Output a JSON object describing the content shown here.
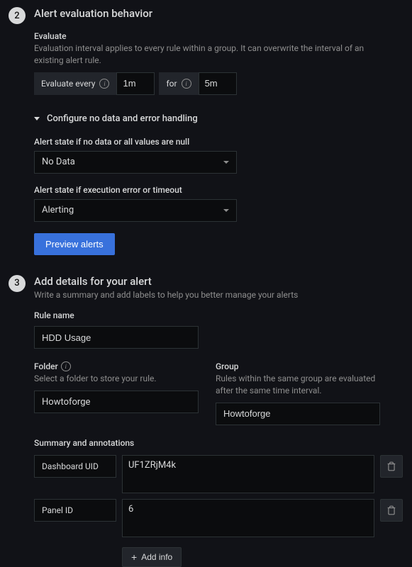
{
  "section2": {
    "step": "2",
    "title": "Alert evaluation behavior",
    "evaluate_label": "Evaluate",
    "evaluate_desc": "Evaluation interval applies to every rule within a group. It can overwrite the interval of an existing alert rule.",
    "evaluate_every_label": "Evaluate every",
    "evaluate_every_value": "1m",
    "for_label": "for",
    "for_value": "5m",
    "collapse_label": "Configure no data and error handling",
    "nodata_label": "Alert state if no data or all values are null",
    "nodata_value": "No Data",
    "execerr_label": "Alert state if execution error or timeout",
    "execerr_value": "Alerting",
    "preview_btn": "Preview alerts"
  },
  "section3": {
    "step": "3",
    "title": "Add details for your alert",
    "subtitle": "Write a summary and add labels to help you better manage your alerts",
    "rulename_label": "Rule name",
    "rulename_value": "HDD Usage",
    "folder_label": "Folder",
    "folder_desc": "Select a folder to store your rule.",
    "folder_value": "Howtoforge",
    "group_label": "Group",
    "group_desc": "Rules within the same group are evaluated after the same time interval.",
    "group_value": "Howtoforge",
    "summary_label": "Summary and annotations",
    "annotations": [
      {
        "key": "Dashboard UID",
        "value": "UF1ZRjM4k"
      },
      {
        "key": "Panel ID",
        "value": "6"
      }
    ],
    "add_info_btn": "Add info"
  }
}
